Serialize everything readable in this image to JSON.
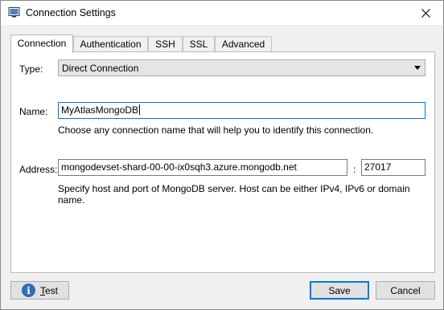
{
  "window": {
    "title": "Connection Settings"
  },
  "tabs": [
    {
      "label": "Connection",
      "active": true
    },
    {
      "label": "Authentication",
      "active": false
    },
    {
      "label": "SSH",
      "active": false
    },
    {
      "label": "SSL",
      "active": false
    },
    {
      "label": "Advanced",
      "active": false
    }
  ],
  "connection": {
    "type_label": "Type:",
    "type_value": "Direct Connection",
    "name_label": "Name:",
    "name_value": "MyAtlasMongoDB",
    "name_hint": "Choose any connection name that will help you to identify this connection.",
    "address_label": "Address:",
    "host_value": "mongodevset-shard-00-00-ix0sqh3.azure.mongodb.net",
    "separator": ":",
    "port_value": "27017",
    "address_hint": "Specify host and port of MongoDB server. Host can be either IPv4, IPv6 or domain name."
  },
  "buttons": {
    "test_first": "T",
    "test_rest": "est",
    "save": "Save",
    "cancel": "Cancel"
  },
  "colors": {
    "focus": "#0078d7",
    "info": "#2f6db5"
  }
}
